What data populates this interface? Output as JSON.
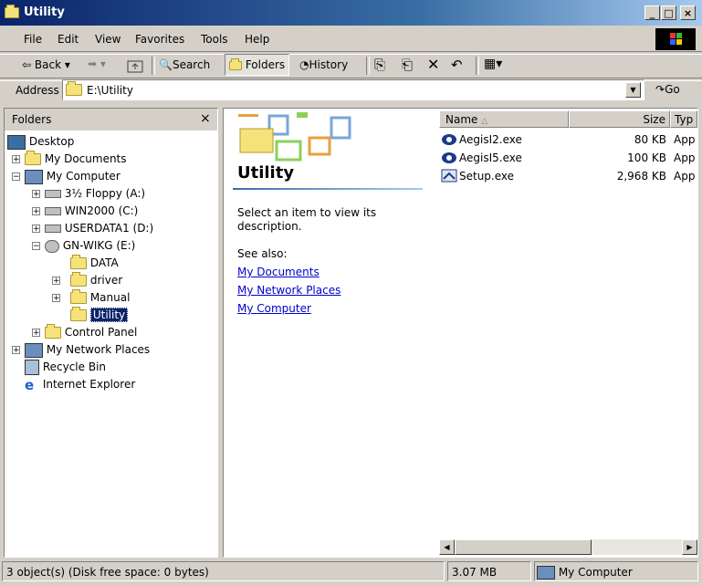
{
  "window": {
    "title": "Utility",
    "min": "_",
    "max": "□",
    "close": "×"
  },
  "menu": [
    "File",
    "Edit",
    "View",
    "Favorites",
    "Tools",
    "Help"
  ],
  "toolbar": {
    "back": "Back",
    "search": "Search",
    "folders": "Folders",
    "history": "History"
  },
  "address": {
    "label": "Address",
    "value": "E:\\Utility",
    "go": "Go"
  },
  "folders_pane": {
    "title": "Folders",
    "close": "×",
    "tree": [
      "Desktop",
      "My Documents",
      "My Computer",
      "3½ Floppy (A:)",
      "WIN2000 (C:)",
      "USERDATA1 (D:)",
      "GN-WIKG (E:)",
      "DATA",
      "driver",
      "Manual",
      "Utility",
      "Control Panel",
      "My Network Places",
      "Recycle Bin",
      "Internet Explorer"
    ]
  },
  "webview": {
    "heading": "Utility",
    "description": "Select an item to view its description.",
    "see_also": "See also:",
    "links": [
      "My Documents",
      "My Network Places",
      "My Computer"
    ]
  },
  "columns": {
    "name": "Name",
    "size": "Size",
    "type": "Typ"
  },
  "files": [
    {
      "name": "AegisI2.exe",
      "size": "80 KB",
      "type": "App"
    },
    {
      "name": "AegisI5.exe",
      "size": "100 KB",
      "type": "App"
    },
    {
      "name": "Setup.exe",
      "size": "2,968 KB",
      "type": "App"
    }
  ],
  "status": {
    "objects": "3 object(s) (Disk free space: 0 bytes)",
    "size": "3.07 MB",
    "location": "My Computer"
  }
}
